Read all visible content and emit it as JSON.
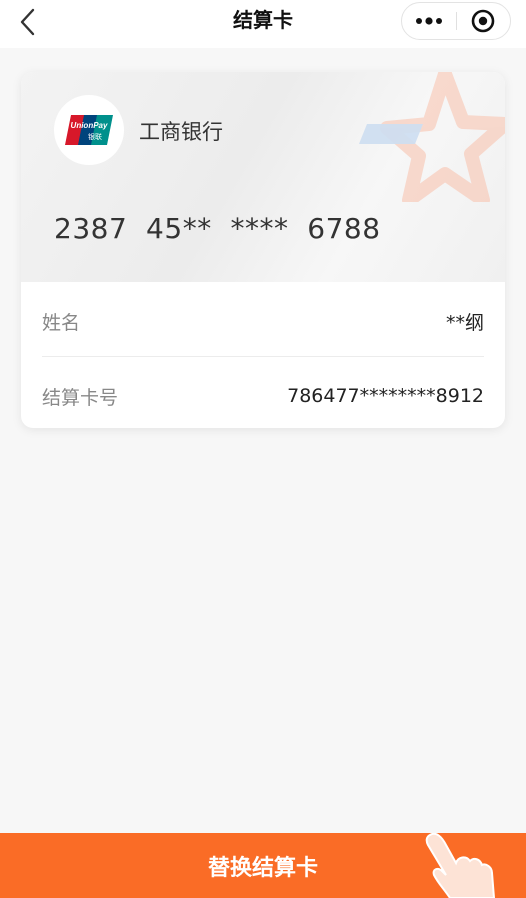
{
  "nav": {
    "title": "结算卡"
  },
  "card": {
    "brand_logo_text": "UnionPay",
    "brand_logo_sub": "银联",
    "bank_name": "工商银行",
    "card_number": "2387  45**  ****  6788"
  },
  "info": {
    "rows": [
      {
        "label": "姓名",
        "value": "**纲"
      },
      {
        "label": "结算卡号",
        "value": "786477********8912"
      }
    ]
  },
  "footer": {
    "button_label": "替换结算卡"
  },
  "colors": {
    "accent": "#fa6c26"
  }
}
